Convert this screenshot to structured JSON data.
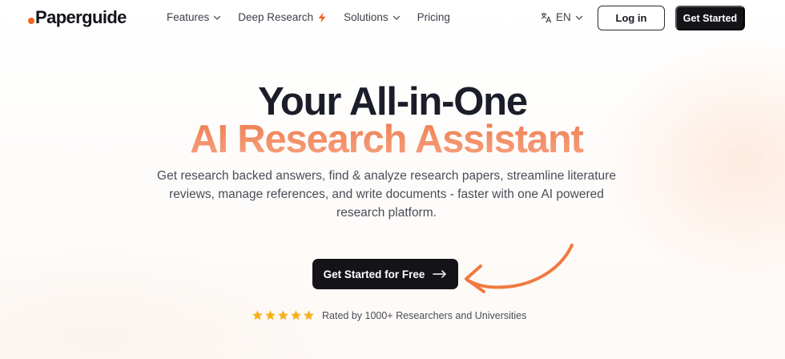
{
  "brand": {
    "name": "Paperguide",
    "dot_color": "#f26522"
  },
  "nav": {
    "items": [
      {
        "label": "Features",
        "icon": "chevron-down-icon"
      },
      {
        "label": "Deep Research",
        "icon": "lightning-bolt-icon"
      },
      {
        "label": "Solutions",
        "icon": "chevron-down-icon"
      },
      {
        "label": "Pricing",
        "icon": ""
      }
    ]
  },
  "language": {
    "icon": "translate-icon",
    "label": "EN"
  },
  "header": {
    "login_label": "Log in",
    "start_label": "Get Started"
  },
  "hero": {
    "title": "Your All-in-One",
    "subtitle": "AI Research Assistant",
    "description": "Get research backed answers, find & analyze research papers, streamline literature reviews, manage references, and write documents - faster with one AI powered research platform.",
    "cta_label": "Get Started for Free",
    "cta_icon": "arrow-right-icon"
  },
  "rating": {
    "stars": 5,
    "text": "Rated by 1000+ Researchers and Universities",
    "star_color": "#f5b01a"
  },
  "colors": {
    "accent": "#f07a4a",
    "dark": "#141418"
  }
}
